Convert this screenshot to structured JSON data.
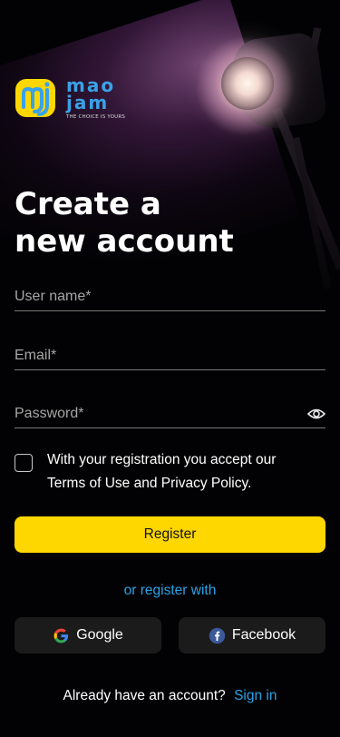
{
  "brand": {
    "name_top": "mao",
    "name_bottom": "jam",
    "tagline": "THE CHOICE IS YOURS",
    "logo_color": "#FFD700",
    "text_color": "#3AA2E8"
  },
  "heading": {
    "line1": "Create a",
    "line2": "new account"
  },
  "form": {
    "username_placeholder": "User name*",
    "email_placeholder": "Email*",
    "password_placeholder": "Password*",
    "show_password_icon": "eye-icon",
    "terms_line1": "With your registration you accept our",
    "terms_line2": "Terms of Use and Privacy Policy.",
    "terms_checked": false
  },
  "actions": {
    "register_label": "Register",
    "or_register_with": "or register with",
    "google_label": "Google",
    "facebook_label": "Facebook",
    "already_account": "Already have an account?",
    "sign_in_label": "Sign in"
  },
  "colors": {
    "primary_button": "#FFD700",
    "link": "#2AA3E8",
    "social_button_bg": "#1B1B1B",
    "background": "#000000"
  }
}
